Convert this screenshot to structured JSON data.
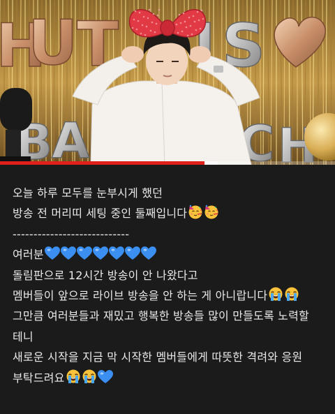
{
  "video": {
    "balloon_letters": [
      "H",
      "U",
      "T",
      "I",
      "S",
      "B",
      "A",
      "C",
      "H"
    ],
    "progress_fraction": 0.61,
    "buffer_fraction": 0.04,
    "colors": {
      "progress": "#e0201a",
      "gold": "#c9a24a",
      "bow": "#e23a44",
      "shirt": "#f5f2ee"
    }
  },
  "caption": {
    "lines": [
      {
        "text": "오늘 하루 모두를 눈부시게 했던",
        "emojis": []
      },
      {
        "text": "방송 전 머리띠 세팅 중인 둘째입니다",
        "emojis": [
          "partying-face",
          "partying-face"
        ]
      },
      {
        "text": "----------------------------",
        "emojis": []
      },
      {
        "text": "여러분",
        "emojis": [
          "blue-heart",
          "blue-heart",
          "blue-heart",
          "blue-heart",
          "blue-heart",
          "blue-heart",
          "blue-heart"
        ]
      },
      {
        "text": "돌림판으로 12시간 방송이 안 나왔다고",
        "emojis": []
      },
      {
        "text": "멤버들이 앞으로 라이브 방송을 안 하는 게 아니랍니다",
        "emojis": [
          "loudly-crying-face",
          "loudly-crying-face"
        ]
      },
      {
        "text": "그만큼 여러분들과 재밌고 행복한 방송들 많이 만들도록 노력할",
        "emojis": []
      },
      {
        "text": "테니",
        "emojis": []
      },
      {
        "text": "새로운 시작을 지금 막 시작한 멤버들에게 따뜻한 격려와 응원",
        "emojis": []
      },
      {
        "text": "부탁드려요",
        "emojis": [
          "loudly-crying-face",
          "loudly-crying-face",
          "blue-heart"
        ]
      }
    ]
  }
}
